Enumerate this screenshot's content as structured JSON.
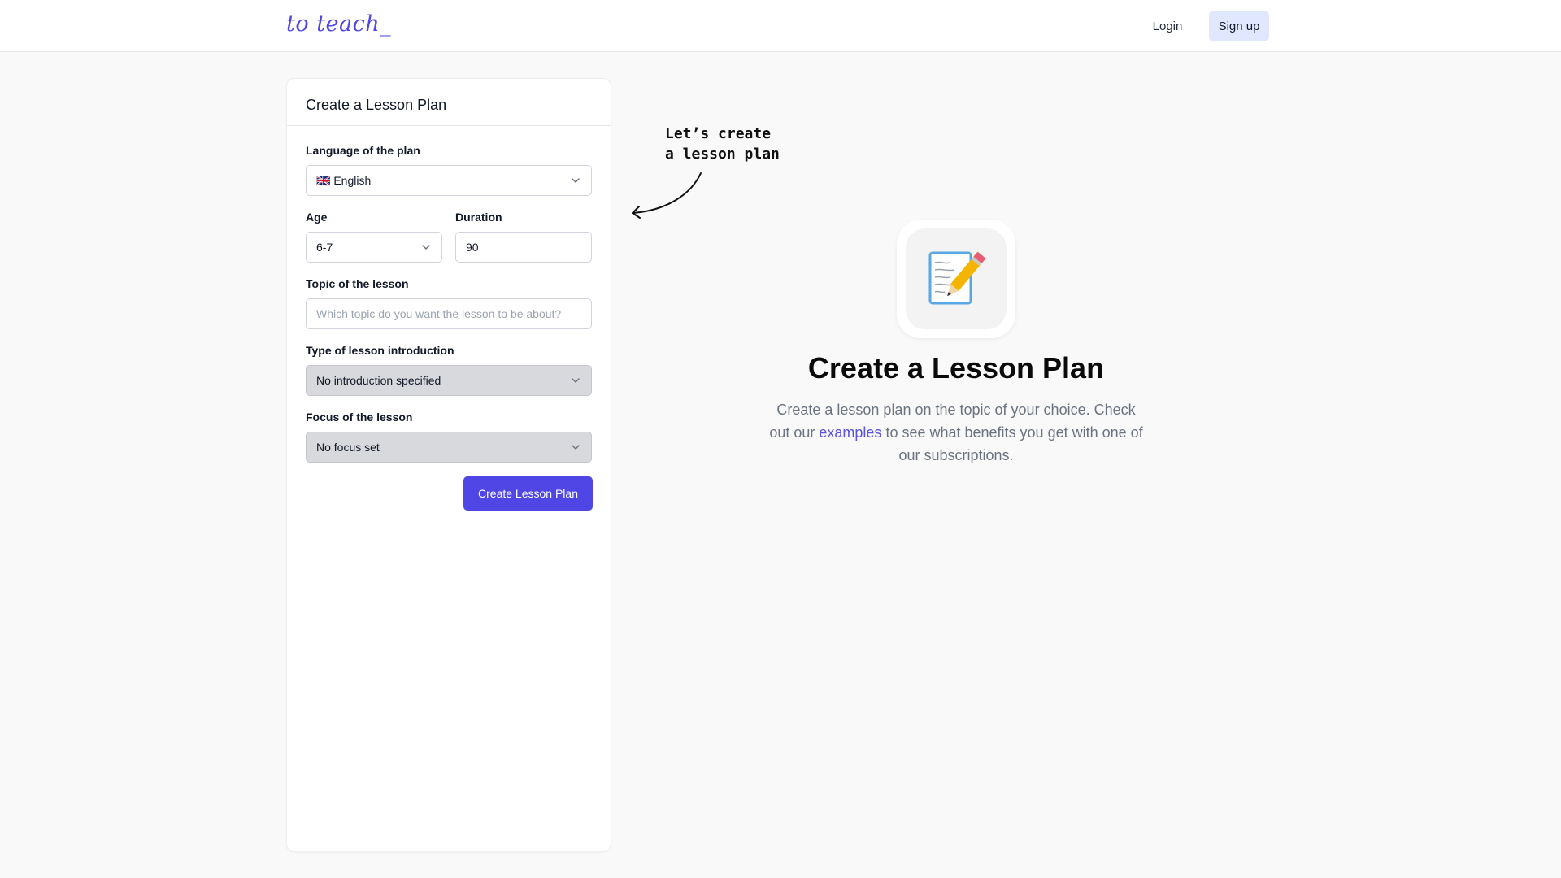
{
  "header": {
    "logo": "to teach_",
    "login_label": "Login",
    "signup_label": "Sign up"
  },
  "form": {
    "title": "Create a Lesson Plan",
    "language": {
      "label": "Language of the plan",
      "value": "🇬🇧 English"
    },
    "age": {
      "label": "Age",
      "value": "6-7"
    },
    "duration": {
      "label": "Duration",
      "value": "90"
    },
    "topic": {
      "label": "Topic of the lesson",
      "value": "",
      "placeholder": "Which topic do you want the lesson to be about?"
    },
    "intro": {
      "label": "Type of lesson introduction",
      "value": "No introduction specified"
    },
    "focus": {
      "label": "Focus of the lesson",
      "value": "No focus set"
    },
    "submit_label": "Create Lesson Plan"
  },
  "annotation": {
    "line1": "Let’s create",
    "line2": "a lesson plan"
  },
  "hero": {
    "icon": "📝",
    "title": "Create a Lesson Plan",
    "desc_before": "Create a lesson plan on the topic of your choice. Check out our ",
    "link": "examples",
    "desc_after": " to see what benefits you get with one of our subscriptions."
  },
  "colors": {
    "accent": "#4f46e5",
    "signup_bg": "#e0e7ff",
    "disabled_select_bg": "#d8d9dc"
  }
}
